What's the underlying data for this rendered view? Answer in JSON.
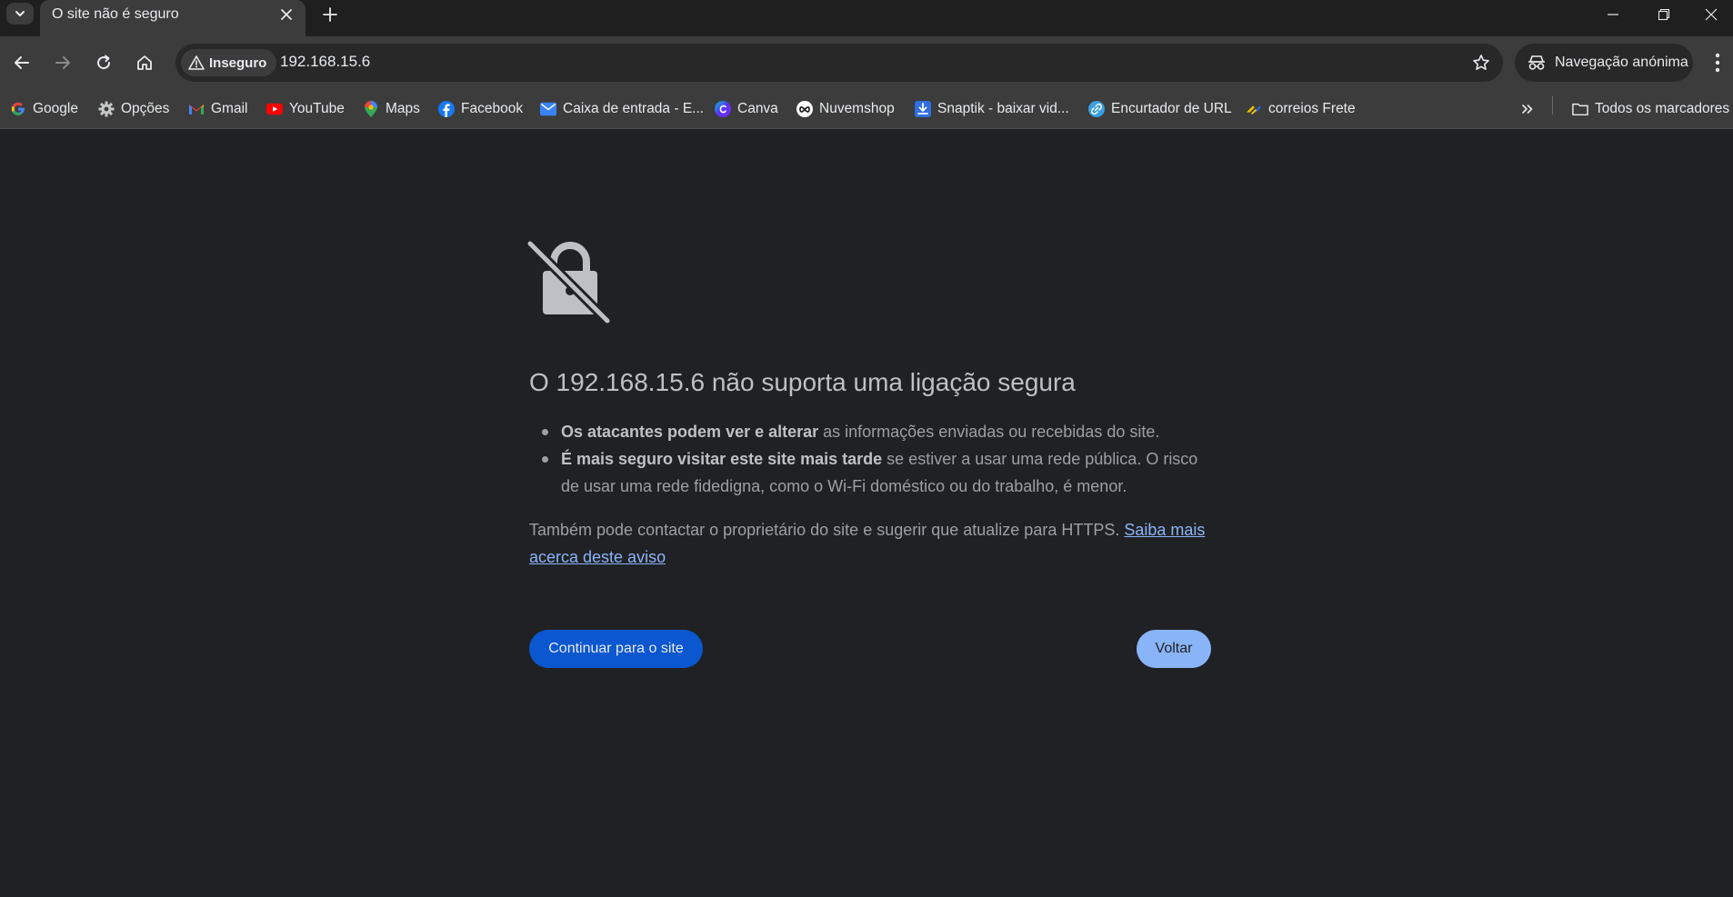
{
  "tabs": {
    "active_title": "O site não é seguro"
  },
  "toolbar": {
    "security_chip": "Inseguro",
    "url": "192.168.15.6",
    "incognito_label": "Navegação anónima"
  },
  "bookmarks": [
    {
      "label": "Google",
      "icon": "google-icon"
    },
    {
      "label": "Opções",
      "icon": "gear-icon"
    },
    {
      "label": "Gmail",
      "icon": "gmail-icon"
    },
    {
      "label": "YouTube",
      "icon": "youtube-icon"
    },
    {
      "label": "Maps",
      "icon": "maps-icon"
    },
    {
      "label": "Facebook",
      "icon": "facebook-icon"
    },
    {
      "label": "Caixa de entrada - E...",
      "icon": "mail-icon"
    },
    {
      "label": "Canva",
      "icon": "canva-icon"
    },
    {
      "label": "Nuvemshop",
      "icon": "nuvemshop-icon"
    },
    {
      "label": "Snaptik - baixar vid...",
      "icon": "download-icon"
    },
    {
      "label": "Encurtador de URL",
      "icon": "link-icon"
    },
    {
      "label": "correios Frete",
      "icon": "correios-icon"
    }
  ],
  "all_bookmarks_label": "Todos os marcadores",
  "interstitial": {
    "heading": "O 192.168.15.6 não suporta uma ligação segura",
    "bullet1_bold": "Os atacantes podem ver e alterar",
    "bullet1_rest": " as informações enviadas ou recebidas do site.",
    "bullet2_bold": "É mais seguro visitar este site mais tarde",
    "bullet2_rest": " se estiver a usar uma rede pública. O risco de usar uma rede fidedigna, como o Wi-Fi doméstico ou do trabalho, é menor.",
    "paragraph": "Também pode contactar o proprietário do site e sugerir que atualize para HTTPS. ",
    "learn_more": "Saiba mais acerca deste aviso",
    "continue_button": "Continuar para o site",
    "back_button": "Voltar"
  },
  "colors": {
    "page_bg": "#202124",
    "accent": "#8ab4f8",
    "primary_button": "#0b57d0"
  }
}
